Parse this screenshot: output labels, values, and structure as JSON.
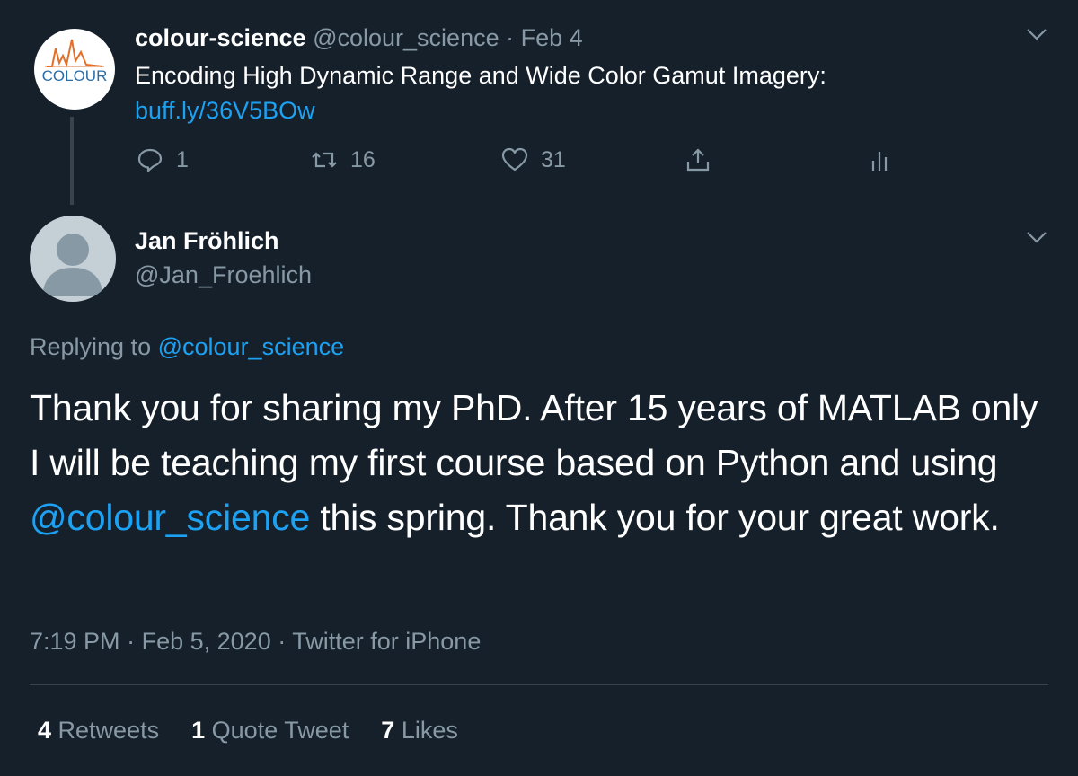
{
  "parent": {
    "avatar_text": "COLOUR",
    "name": "colour-science",
    "handle": "@colour_science",
    "sep": "·",
    "date": "Feb 4",
    "text": "Encoding High Dynamic Range and Wide Color Gamut Imagery:",
    "link": "buff.ly/36V5BOw",
    "actions": {
      "reply_count": "1",
      "retweet_count": "16",
      "like_count": "31"
    }
  },
  "reply": {
    "name": "Jan Fröhlich",
    "handle": "@Jan_Froehlich",
    "replying_prefix": "Replying to",
    "replying_handle": "@colour_science",
    "body_part1": "Thank you for sharing my PhD. After 15 years of MATLAB only I will be teaching my first course based on Python and using",
    "body_mention": "@colour_science",
    "body_part2": "this spring. Thank you for your great work.",
    "time": "7:19 PM",
    "sep1": "·",
    "date": "Feb 5, 2020",
    "sep2": "·",
    "source": "Twitter for iPhone",
    "stats": {
      "retweets_num": "4",
      "retweets_label": "Retweets",
      "quotes_num": "1",
      "quotes_label": "Quote Tweet",
      "likes_num": "7",
      "likes_label": "Likes"
    }
  },
  "colors": {
    "background": "#15202b",
    "accent": "#1da1f2",
    "muted": "#8899a6",
    "divider": "#38444d"
  },
  "icons": {
    "reply": "reply-icon",
    "retweet": "retweet-icon",
    "like": "heart-icon",
    "share": "share-icon",
    "analytics": "analytics-icon",
    "more": "chevron-down-icon"
  }
}
